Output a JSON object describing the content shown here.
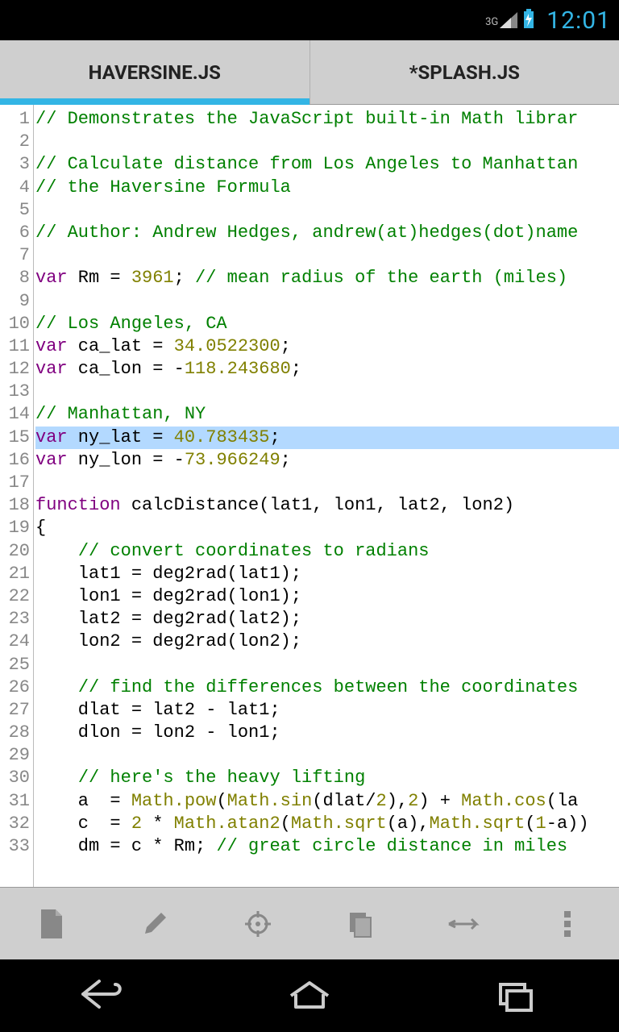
{
  "status": {
    "network": "3G",
    "time": "12:01"
  },
  "tabs": [
    {
      "label": "HAVERSINE.JS",
      "active": true
    },
    {
      "label": "*SPLASH.JS",
      "active": false
    }
  ],
  "highlighted_line": 15,
  "code_lines": [
    [
      {
        "t": "comment",
        "v": "// Demonstrates the JavaScript built-in Math librar"
      }
    ],
    [],
    [
      {
        "t": "comment",
        "v": "// Calculate distance from Los Angeles to Manhattan"
      }
    ],
    [
      {
        "t": "comment",
        "v": "// the Haversine Formula"
      }
    ],
    [],
    [
      {
        "t": "comment",
        "v": "// Author: Andrew Hedges, andrew(at)hedges(dot)name"
      }
    ],
    [],
    [
      {
        "t": "keyword",
        "v": "var"
      },
      {
        "t": "plain",
        "v": " Rm = "
      },
      {
        "t": "number",
        "v": "3961"
      },
      {
        "t": "plain",
        "v": "; "
      },
      {
        "t": "comment",
        "v": "// mean radius of the earth (miles)"
      }
    ],
    [],
    [
      {
        "t": "comment",
        "v": "// Los Angeles, CA"
      }
    ],
    [
      {
        "t": "keyword",
        "v": "var"
      },
      {
        "t": "plain",
        "v": " ca_lat = "
      },
      {
        "t": "number",
        "v": "34.0522300"
      },
      {
        "t": "plain",
        "v": ";"
      }
    ],
    [
      {
        "t": "keyword",
        "v": "var"
      },
      {
        "t": "plain",
        "v": " ca_lon = -"
      },
      {
        "t": "number",
        "v": "118.243680"
      },
      {
        "t": "plain",
        "v": ";"
      }
    ],
    [],
    [
      {
        "t": "comment",
        "v": "// Manhattan, NY"
      }
    ],
    [
      {
        "t": "keyword",
        "v": "var"
      },
      {
        "t": "plain",
        "v": " ny_lat = "
      },
      {
        "t": "number",
        "v": "40.783435"
      },
      {
        "t": "plain",
        "v": ";"
      }
    ],
    [
      {
        "t": "keyword",
        "v": "var"
      },
      {
        "t": "plain",
        "v": " ny_lon = -"
      },
      {
        "t": "number",
        "v": "73.966249"
      },
      {
        "t": "plain",
        "v": ";"
      }
    ],
    [],
    [
      {
        "t": "keyword",
        "v": "function"
      },
      {
        "t": "plain",
        "v": " calcDistance(lat1, lon1, lat2, lon2)"
      }
    ],
    [
      {
        "t": "plain",
        "v": "{"
      }
    ],
    [
      {
        "t": "plain",
        "v": "    "
      },
      {
        "t": "comment",
        "v": "// convert coordinates to radians"
      }
    ],
    [
      {
        "t": "plain",
        "v": "    lat1 = deg2rad(lat1);"
      }
    ],
    [
      {
        "t": "plain",
        "v": "    lon1 = deg2rad(lon1);"
      }
    ],
    [
      {
        "t": "plain",
        "v": "    lat2 = deg2rad(lat2);"
      }
    ],
    [
      {
        "t": "plain",
        "v": "    lon2 = deg2rad(lon2);"
      }
    ],
    [],
    [
      {
        "t": "plain",
        "v": "    "
      },
      {
        "t": "comment",
        "v": "// find the differences between the coordinates"
      }
    ],
    [
      {
        "t": "plain",
        "v": "    dlat = lat2 - lat1;"
      }
    ],
    [
      {
        "t": "plain",
        "v": "    dlon = lon2 - lon1;"
      }
    ],
    [],
    [
      {
        "t": "plain",
        "v": "    "
      },
      {
        "t": "comment",
        "v": "// here's the heavy lifting"
      }
    ],
    [
      {
        "t": "plain",
        "v": "    a  = "
      },
      {
        "t": "lib",
        "v": "Math.pow"
      },
      {
        "t": "plain",
        "v": "("
      },
      {
        "t": "lib",
        "v": "Math.sin"
      },
      {
        "t": "plain",
        "v": "(dlat/"
      },
      {
        "t": "number",
        "v": "2"
      },
      {
        "t": "plain",
        "v": "),"
      },
      {
        "t": "number",
        "v": "2"
      },
      {
        "t": "plain",
        "v": ") + "
      },
      {
        "t": "lib",
        "v": "Math.cos"
      },
      {
        "t": "plain",
        "v": "(la"
      }
    ],
    [
      {
        "t": "plain",
        "v": "    c  = "
      },
      {
        "t": "number",
        "v": "2"
      },
      {
        "t": "plain",
        "v": " * "
      },
      {
        "t": "lib",
        "v": "Math.atan2"
      },
      {
        "t": "plain",
        "v": "("
      },
      {
        "t": "lib",
        "v": "Math.sqrt"
      },
      {
        "t": "plain",
        "v": "(a),"
      },
      {
        "t": "lib",
        "v": "Math.sqrt"
      },
      {
        "t": "plain",
        "v": "("
      },
      {
        "t": "number",
        "v": "1"
      },
      {
        "t": "plain",
        "v": "-a))"
      }
    ],
    [
      {
        "t": "plain",
        "v": "    dm = c * Rm; "
      },
      {
        "t": "comment",
        "v": "// great circle distance in miles"
      }
    ]
  ],
  "toolbar": {
    "icons": [
      "file-icon",
      "edit-icon",
      "target-icon",
      "copy-icon",
      "run-icon",
      "overflow-icon"
    ]
  },
  "nav": {
    "back": "back-icon",
    "home": "home-icon",
    "recent": "recent-icon"
  }
}
